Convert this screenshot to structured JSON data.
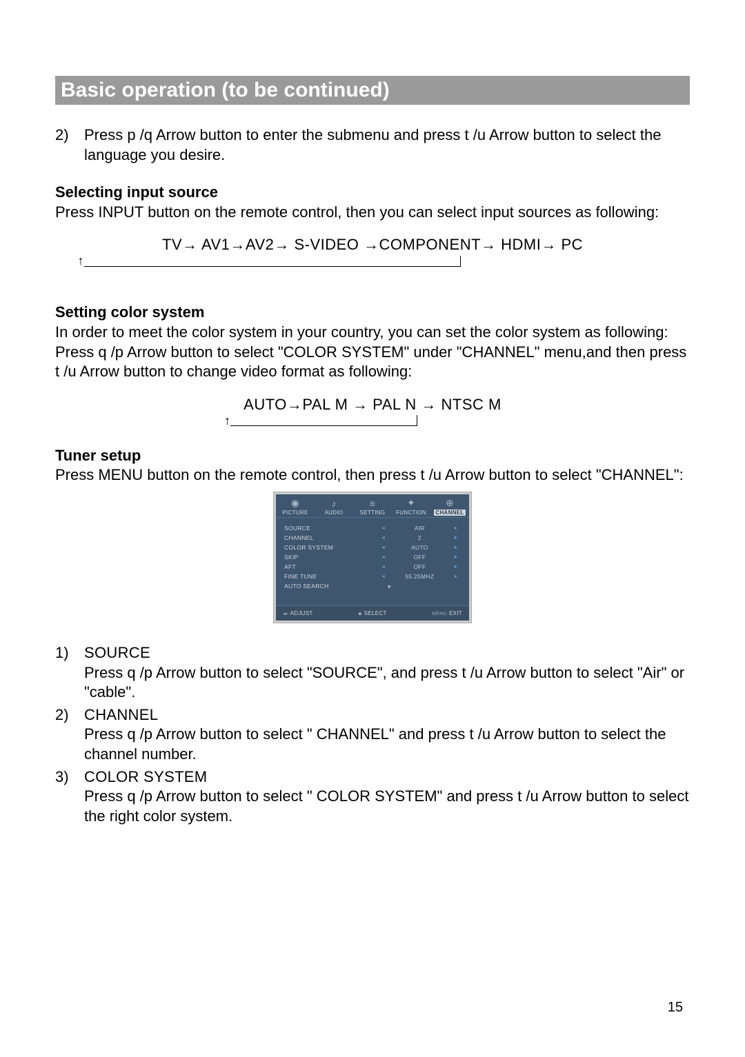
{
  "title": "Basic operation (to be continued)",
  "step2": {
    "num": "2)",
    "text": "Press p /q  Arrow button to enter the submenu  and press t /u  Arrow button to select the language you desire."
  },
  "sec_input": {
    "heading": "Selecting input source",
    "text": "Press INPUT button on the remote control, then you can select input sources as following:",
    "flow": "TV→ AV1→AV2→ S-VIDEO →COMPONENT→ HDMI→  PC"
  },
  "sec_color": {
    "heading": "Setting color system",
    "text": "In order to meet the color system in your country, you can set the color system as following: Press q /p  Arrow button to select \"COLOR SYSTEM\" under \"CHANNEL\" menu,and then press t /u  Arrow button to change video format as following:",
    "flow": "AUTO→PAL M  →   PAL N  →   NTSC M"
  },
  "sec_tuner": {
    "heading": "Tuner setup",
    "text": "Press MENU button on the remote control, then press t /u  Arrow button to select \"CHANNEL\":"
  },
  "osd": {
    "tabs": [
      "PICTURE",
      "AUDIO",
      "SETTING",
      "FUNCTION",
      "CHANNEL"
    ],
    "rows": [
      {
        "name": "SOURCE",
        "val": "AIR",
        "l": true,
        "r": true
      },
      {
        "name": "CHANNEL",
        "val": "2",
        "l": true,
        "r": true
      },
      {
        "name": "COLOR SYSTEM",
        "val": "AUTO",
        "l": true,
        "r": true
      },
      {
        "name": "SKIP",
        "val": "OFF",
        "l": true,
        "r": true
      },
      {
        "name": "AFT",
        "val": "OFF",
        "l": true,
        "r": true
      },
      {
        "name": "FINE TUNE",
        "val": "55.25MHZ",
        "l": true,
        "r": true
      },
      {
        "name": "AUTO SEARCH",
        "val": "",
        "l": false,
        "r": true
      }
    ],
    "footer": {
      "adjust": "ADJUST",
      "select": "SELECT",
      "exit_k": "MENU",
      "exit": "EXIT"
    }
  },
  "numbered": [
    {
      "n": "1)",
      "head": "SOURCE",
      "body": "Press q /p  Arrow button to select \"SOURCE\", and press t /u  Arrow button to select  \"Air\" or \"cable\"."
    },
    {
      "n": "2)",
      "head": "CHANNEL",
      "body": "Press q /p  Arrow button to select \" CHANNEL\"  and press t /u  Arrow button to select the channel number."
    },
    {
      "n": "3)",
      "head": "COLOR SYSTEM",
      "body": "Press q /p  Arrow button to select \" COLOR SYSTEM\"  and press t /u  Arrow button to select the right color system."
    }
  ],
  "page_number": "15"
}
